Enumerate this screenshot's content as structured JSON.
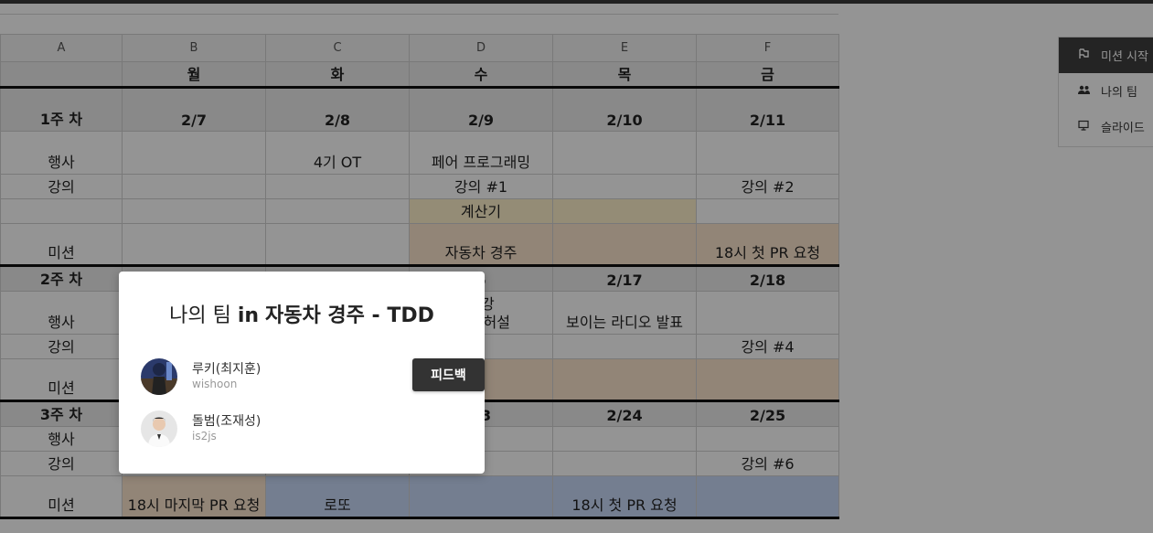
{
  "sheet": {
    "columns": [
      "A",
      "B",
      "C",
      "D",
      "E",
      "F"
    ],
    "day_row": [
      "",
      "월",
      "화",
      "수",
      "목",
      "금"
    ],
    "week1": {
      "header": [
        "1주 차",
        "2/7",
        "2/8",
        "2/9",
        "2/10",
        "2/11"
      ],
      "event": [
        "행사",
        "",
        "4기 OT",
        "페어 프로그래밍",
        "",
        ""
      ],
      "lecture": [
        "강의",
        "",
        "",
        "강의 #1",
        "",
        "강의 #2"
      ],
      "calc": [
        "",
        "",
        "",
        "계산기",
        "",
        ""
      ],
      "mission": [
        "미션",
        "",
        "",
        "자동차 경주",
        "",
        "18시 첫 PR 요청"
      ]
    },
    "week2": {
      "header": [
        "2주 차",
        "",
        "",
        "6",
        "2/17",
        "2/18"
      ],
      "event": [
        "행사",
        "",
        "",
        "특강\n오 리허설",
        "보이는 라디오 발표",
        ""
      ],
      "lecture": [
        "강의",
        "",
        "",
        "",
        "",
        "강의 #4"
      ],
      "mission": [
        "미션",
        "",
        "",
        "",
        "",
        ""
      ]
    },
    "week3": {
      "header": [
        "3주 차",
        "",
        "",
        "23",
        "2/24",
        "2/25"
      ],
      "event": [
        "행사",
        "",
        "",
        "",
        "",
        ""
      ],
      "lecture": [
        "강의",
        "",
        "",
        "",
        "",
        "강의 #6"
      ],
      "mission": [
        "미션",
        "18시 마지막 PR 요청",
        "로또",
        "",
        "18시 첫 PR 요청",
        ""
      ]
    }
  },
  "sidemenu": {
    "items": [
      {
        "label": "미션 시작",
        "icon": "flag-icon",
        "active": true
      },
      {
        "label": "나의 팀",
        "icon": "people-icon",
        "active": false
      },
      {
        "label": "슬라이드",
        "icon": "monitor-icon",
        "active": false
      }
    ]
  },
  "modal": {
    "title_prefix": "나의 팀",
    "title_in": "in",
    "title_mission": "자동차 경주 - TDD",
    "members": [
      {
        "name": "루키(최지훈)",
        "id": "wishoon"
      },
      {
        "name": "돌범(조재성)",
        "id": "is2js"
      }
    ],
    "feedback_label": "피드백"
  },
  "colors": {
    "overlay": "rgba(0,0,0,0.42)",
    "button": "#333333",
    "active_menu": "#3e3e3e",
    "yellow_cell": "#fff2cc",
    "orange_cell": "#fce5cd",
    "blue_cell": "#c9daf8"
  }
}
